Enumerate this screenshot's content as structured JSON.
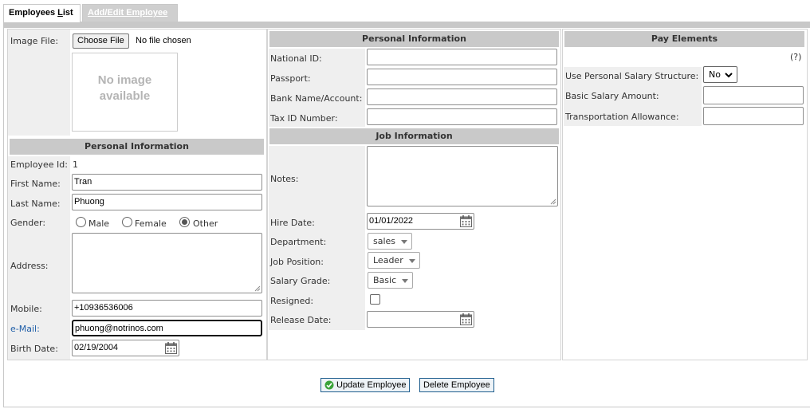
{
  "tabs": {
    "list_prefix": "Employees ",
    "list_accel": "L",
    "list_suffix": "ist",
    "edit_label": "Add/Edit Employee"
  },
  "image": {
    "label": "Image File:",
    "choose_label": "Choose File",
    "file_status": "No file chosen",
    "no_image_line1": "No image",
    "no_image_line2": "available"
  },
  "personal_left": {
    "title": "Personal Information",
    "employee_id_label": "Employee Id:",
    "employee_id": "1",
    "first_name_label": "First Name:",
    "first_name": "Tran",
    "last_name_label": "Last Name:",
    "last_name": "Phuong",
    "gender_label": "Gender:",
    "gender_options": [
      "Male",
      "Female",
      "Other"
    ],
    "gender_selected": "Other",
    "address_label": "Address:",
    "address": "",
    "mobile_label": "Mobile:",
    "mobile": "+10936536006",
    "email_label": "e-Mail:",
    "email": "phuong@notrinos.com",
    "birth_date_label": "Birth Date:",
    "birth_date": "02/19/2004"
  },
  "personal_mid": {
    "title": "Personal Information",
    "national_id_label": "National ID:",
    "national_id": "",
    "passport_label": "Passport:",
    "passport": "",
    "bank_label": "Bank Name/Account:",
    "bank": "",
    "tax_label": "Tax ID Number:",
    "tax": ""
  },
  "job": {
    "title": "Job Information",
    "notes_label": "Notes:",
    "notes": "",
    "hire_date_label": "Hire Date:",
    "hire_date": "01/01/2022",
    "department_label": "Department:",
    "department": "sales",
    "position_label": "Job Position:",
    "position": "Leader",
    "grade_label": "Salary Grade:",
    "grade": "Basic",
    "resigned_label": "Resigned:",
    "resigned": false,
    "release_date_label": "Release Date:",
    "release_date": ""
  },
  "pay": {
    "title": "Pay Elements",
    "help": "(?)",
    "personal_structure_label": "Use Personal Salary Structure:",
    "personal_structure": "No",
    "basic_salary_label": "Basic Salary Amount:",
    "basic_salary": "",
    "transport_label": "Transportation Allowance:",
    "transport": ""
  },
  "actions": {
    "update_label": "Update Employee",
    "delete_label": "Delete Employee"
  },
  "colors": {
    "link_blue": "#1f5ea8",
    "header_gray": "#c9c9c9",
    "label_bg": "#efefef",
    "button_border": "#1f5e8e",
    "check_green": "#3aa33a"
  },
  "icons": {
    "calendar": "calendar-icon",
    "check": "check-circle-icon",
    "dropdown": "chevron-down-icon"
  }
}
